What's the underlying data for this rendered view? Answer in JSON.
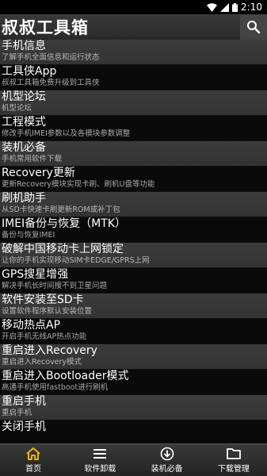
{
  "status": {
    "time": "2:10"
  },
  "app": {
    "title": "叔叔工具箱"
  },
  "menu": [
    {
      "title": "手机信息",
      "subtitle": "了解手机全面信息和运行状态"
    },
    {
      "title": "工具侠App",
      "subtitle": "叔叔工具箱免费升级到工具侠"
    },
    {
      "title": "机型论坛",
      "subtitle": "机型论坛"
    },
    {
      "title": "工程模式",
      "subtitle": "修改手机IMEI参数以及各模块参数调整"
    },
    {
      "title": "装机必备",
      "subtitle": "手机常用软件下载"
    },
    {
      "title": "Recovery更新",
      "subtitle": "更新Recovery模块实现卡刷、刷机U盘等功能"
    },
    {
      "title": "刷机助手",
      "subtitle": "从SD卡快速卡刷更新ROM或补丁包"
    },
    {
      "title": "IMEI备份与恢复（MTK）",
      "subtitle": "备份与恢复IMEI"
    },
    {
      "title": "破解中国移动卡上网锁定",
      "subtitle": "让你的手机实现移动SIM卡EDGE/GPRS上网"
    },
    {
      "title": "GPS搜星增强",
      "subtitle": "解决手机长时间搜不到卫星问题"
    },
    {
      "title": "软件安装至SD卡",
      "subtitle": "设置软件程序默认安装位置"
    },
    {
      "title": "移动热点AP",
      "subtitle": "开启手机无线AP热点功能"
    },
    {
      "title": "重启进入Recovery",
      "subtitle": "重启进入Recovery模式"
    },
    {
      "title": "重启进入Bootloader模式",
      "subtitle": "高通手机使用fastboot进行刷机"
    },
    {
      "title": "重启手机",
      "subtitle": "重启手机"
    },
    {
      "title": "关闭手机",
      "subtitle": ""
    }
  ],
  "nav": [
    {
      "label": "首页",
      "icon": "home-icon",
      "active": true
    },
    {
      "label": "软件卸载",
      "icon": "list-icon"
    },
    {
      "label": "装机必备",
      "icon": "download-icon"
    },
    {
      "label": "下载管理",
      "icon": "folder-icon"
    }
  ],
  "colors": {
    "accent": "#f5b400",
    "row_dark": "#0a0a0a",
    "row_light": "#3a3a3a"
  }
}
